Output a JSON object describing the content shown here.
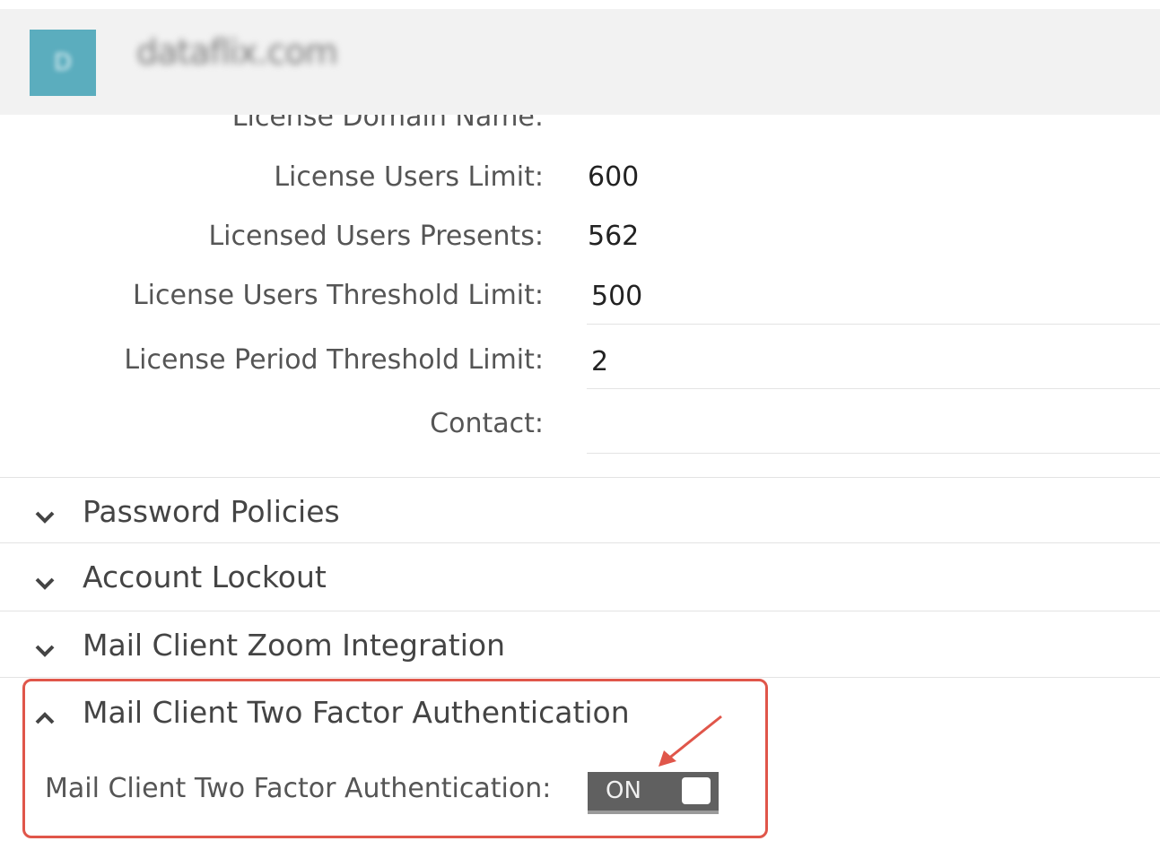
{
  "header": {
    "avatar_letter": "D",
    "domain_name": "dataflix.com"
  },
  "license": {
    "domain_name_label": "License Domain Name:",
    "users_limit_label": "License Users Limit:",
    "users_limit_value": "600",
    "users_present_label": "Licensed Users Presents:",
    "users_present_value": "562",
    "users_threshold_label": "License Users Threshold Limit:",
    "users_threshold_value": "500",
    "period_threshold_label": "License Period Threshold Limit:",
    "period_threshold_value": "2",
    "contact_label": "Contact:",
    "contact_value": ""
  },
  "sections": [
    {
      "title": "Password Policies",
      "expanded": false
    },
    {
      "title": "Account Lockout",
      "expanded": false
    },
    {
      "title": "Mail Client Zoom Integration",
      "expanded": false
    },
    {
      "title": "Mail Client Two Factor Authentication",
      "expanded": true
    }
  ],
  "two_factor": {
    "label": "Mail Client Two Factor Authentication:",
    "toggle_text": "ON",
    "enabled": true
  },
  "colors": {
    "avatar": "#5badbe",
    "highlight": "#e0564a",
    "toggle_bg": "#606060"
  },
  "icons": {
    "collapsed": "chevron-down-icon",
    "expanded": "chevron-up-icon"
  }
}
